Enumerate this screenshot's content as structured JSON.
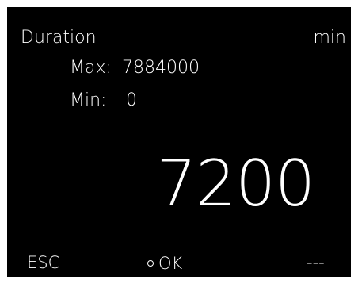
{
  "parameter": {
    "name": "Duration",
    "unit": "min"
  },
  "limits": {
    "max_label": "Max:",
    "max_value": "7884000",
    "min_label": "Min:",
    "min_value": "0"
  },
  "value": "7200",
  "softkeys": {
    "left": "ESC",
    "center": "OK",
    "center_icon": "rotary-dial-icon",
    "right": "---"
  },
  "colors": {
    "background": "#000000",
    "text": "#ffffff"
  }
}
